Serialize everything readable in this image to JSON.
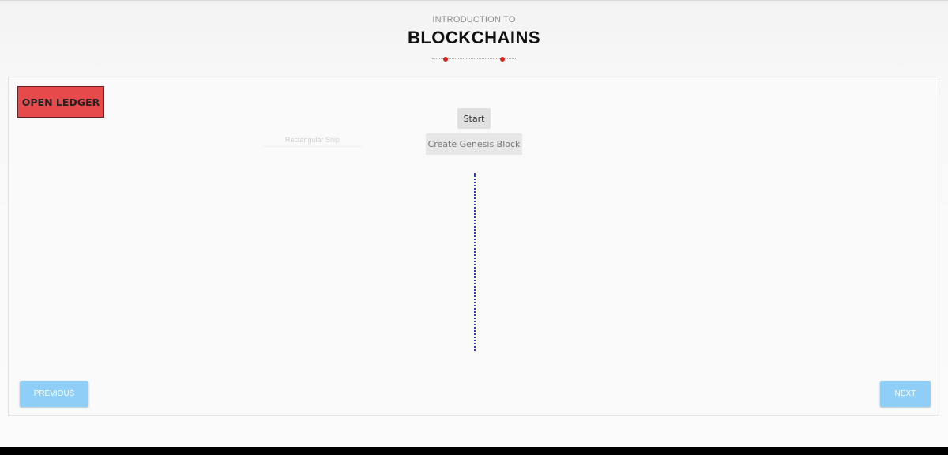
{
  "header": {
    "subtitle": "INTRODUCTION TO",
    "title": "BLOCKCHAINS"
  },
  "colors": {
    "accent_red": "#d9251d",
    "ledger_button": "#e64a4a",
    "nav_button": "#8fcff7",
    "chain_line": "#2b39d6"
  },
  "toolbar": {
    "open_ledger_label": "OPEN LEDGER"
  },
  "controls": {
    "start_label": "Start",
    "genesis_label": "Create Genesis Block"
  },
  "overlay": {
    "snip_label": "Rectangular Snip"
  },
  "navigation": {
    "previous_label": "PREVIOUS",
    "next_label": "NEXT"
  }
}
